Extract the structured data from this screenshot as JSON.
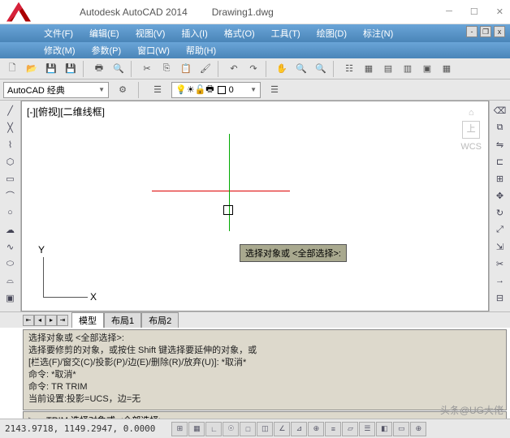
{
  "title": {
    "app": "Autodesk AutoCAD 2014",
    "file": "Drawing1.dwg"
  },
  "menu1": [
    {
      "l": "文件(F)"
    },
    {
      "l": "编辑(E)"
    },
    {
      "l": "视图(V)"
    },
    {
      "l": "插入(I)"
    },
    {
      "l": "格式(O)"
    },
    {
      "l": "工具(T)"
    },
    {
      "l": "绘图(D)"
    },
    {
      "l": "标注(N)"
    }
  ],
  "menu2": [
    {
      "l": "修改(M)"
    },
    {
      "l": "参数(P)"
    },
    {
      "l": "窗口(W)"
    },
    {
      "l": "帮助(H)"
    }
  ],
  "workspace": "AutoCAD 经典",
  "layer": "0",
  "viewport_label": "[-][俯视][二维线框]",
  "wcs": "WCS",
  "ucs": {
    "x": "X",
    "y": "Y"
  },
  "tooltip": "选择对象或 <全部选择>:",
  "tabs": [
    {
      "l": "模型",
      "active": true
    },
    {
      "l": "布局1",
      "active": false
    },
    {
      "l": "布局2",
      "active": false
    }
  ],
  "cmd_history": [
    "选择对象或 <全部选择>:",
    "选择要修剪的对象，或按住 Shift 键选择要延伸的对象，或",
    "[栏选(F)/窗交(C)/投影(P)/边(E)/删除(R)/放弃(U)]: *取消*",
    "命令: *取消*",
    "命令: TR TRIM",
    "当前设置:投影=UCS，边=无"
  ],
  "cmd_prompt": "TRIM 选择对象或 <全部选择>:",
  "coords": "2143.9718, 1149.2947, 0.0000",
  "watermark": "头条@UG大佬"
}
